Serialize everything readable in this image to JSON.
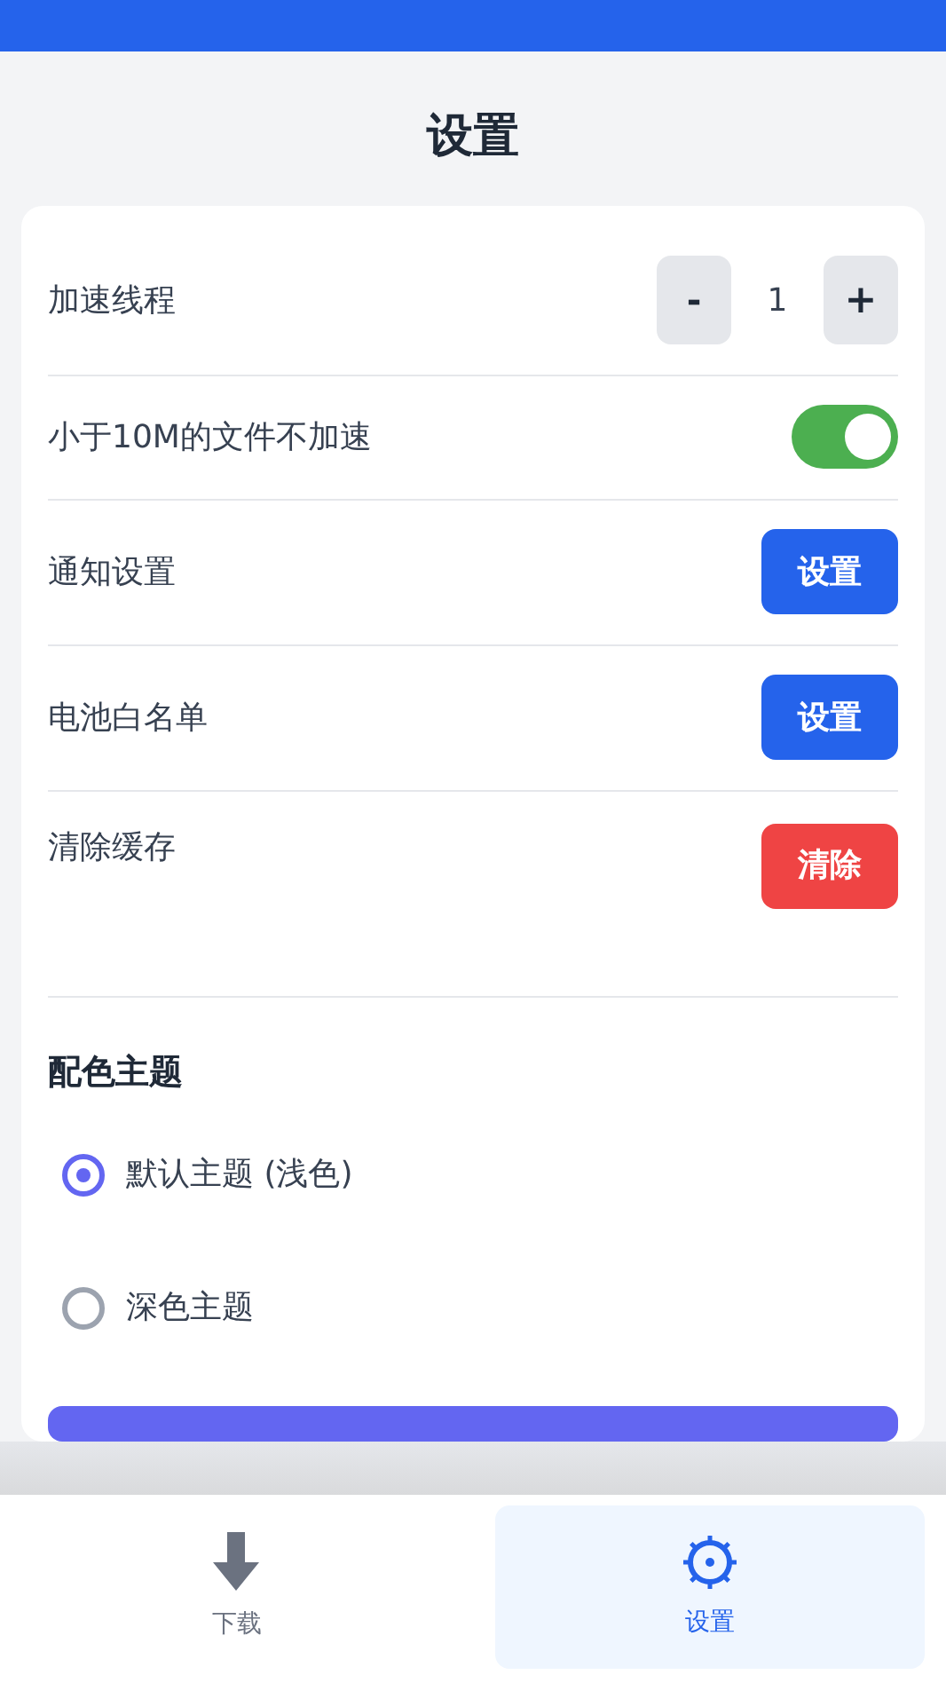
{
  "title": "设置",
  "settings": [
    {
      "kind": "stepper",
      "label": "加速线程",
      "decrement": "-",
      "value": "1",
      "increment": "+"
    },
    {
      "kind": "toggle",
      "label": "小于10M的文件不加速",
      "on": true
    },
    {
      "kind": "button",
      "label": "通知设置",
      "button": "设置",
      "color": "#2563eb"
    },
    {
      "kind": "button",
      "label": "电池白名单",
      "button": "设置",
      "color": "#2563eb"
    },
    {
      "kind": "button",
      "label": "清除缓存",
      "button": "清除",
      "color": "#ef4444"
    }
  ],
  "theme": {
    "heading": "配色主题",
    "options": [
      {
        "label": "默认主题 (浅色)",
        "selected": true
      },
      {
        "label": "深色主题",
        "selected": false
      }
    ]
  },
  "nav": [
    {
      "kind": "download",
      "label": "下载",
      "selected": false
    },
    {
      "kind": "settings",
      "label": "设置",
      "selected": true
    }
  ]
}
